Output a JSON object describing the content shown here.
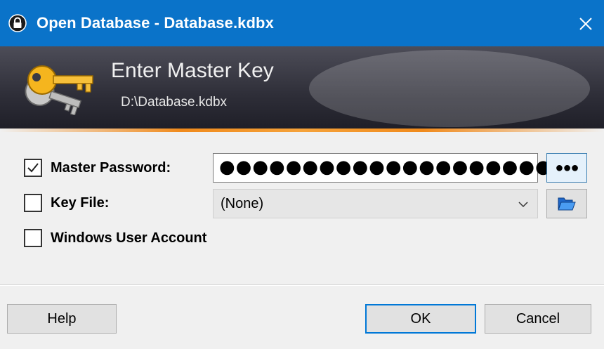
{
  "window": {
    "title": "Open Database - Database.kdbx",
    "icon": "lock-icon",
    "close_glyph": "✕"
  },
  "banner": {
    "heading": "Enter Master Key",
    "path": "D:\\Database.kdbx",
    "icon": "keys-icon"
  },
  "master_password": {
    "label": "Master Password:",
    "checked": true,
    "value": "●●●●●●●●●●●●●●●●●●●●",
    "reveal_label": "●●●"
  },
  "key_file": {
    "label": "Key File:",
    "checked": false,
    "selected": "(None)",
    "browse_icon": "folder-open-icon"
  },
  "windows_account": {
    "label": "Windows User Account",
    "checked": false
  },
  "buttons": {
    "help": "Help",
    "ok": "OK",
    "cancel": "Cancel"
  },
  "colors": {
    "titlebar": "#0a73c9",
    "accent_line": "#f08a1c",
    "focus_border": "#0078d7"
  }
}
